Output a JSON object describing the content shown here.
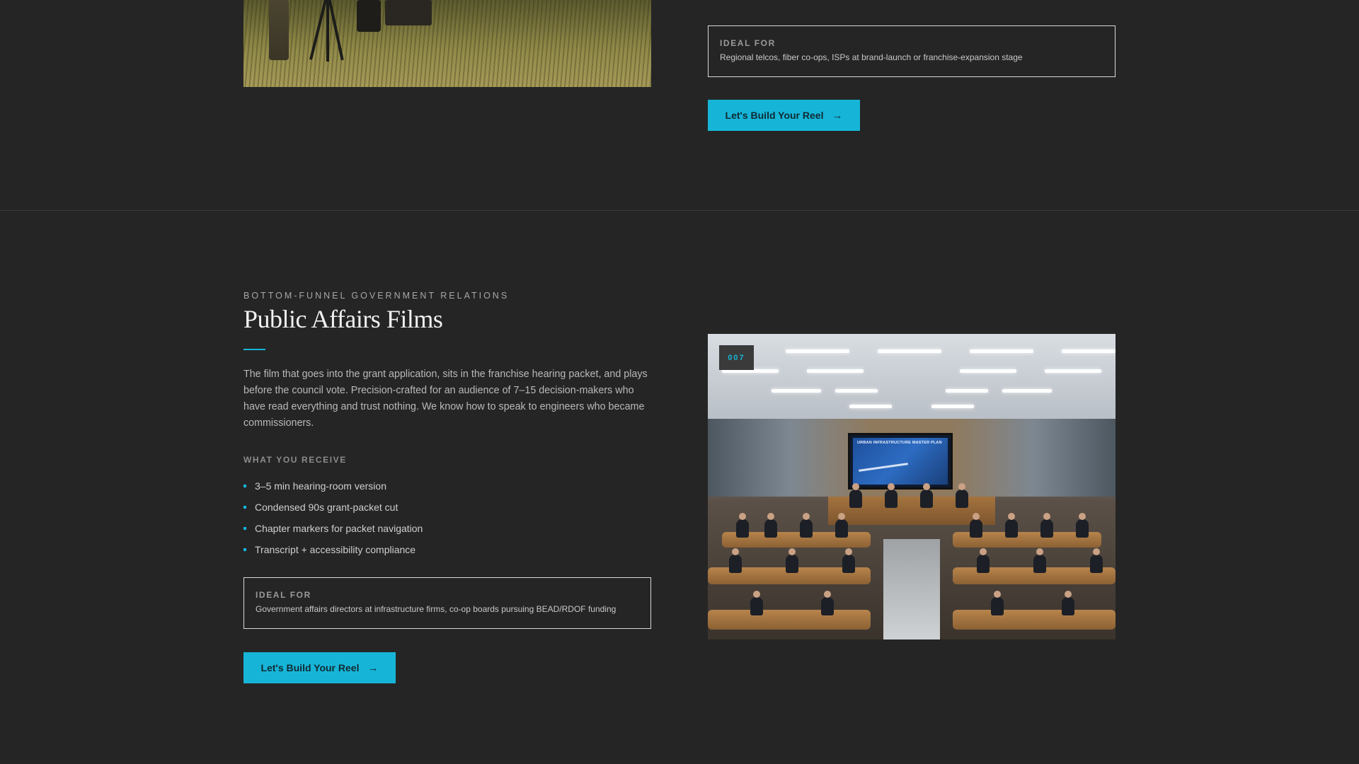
{
  "section_top": {
    "ideal": {
      "label": "IDEAL FOR",
      "text": "Regional telcos, fiber co-ops, ISPs at brand-launch or franchise-expansion stage"
    },
    "cta_label": "Let's Build Your Reel",
    "cta_icon": "arrow-right-icon"
  },
  "section_public_affairs": {
    "eyebrow": "BOTTOM-FUNNEL GOVERNMENT RELATIONS",
    "title": "Public Affairs Films",
    "description": "The film that goes into the grant application, sits in the franchise hearing packet, and plays before the council vote. Precision-crafted for an audience of 7–15 decision-makers who have read everything and trust nothing. We know how to speak to engineers who became commissioners.",
    "receive_label": "WHAT YOU RECEIVE",
    "receive_items": [
      "3–5 min hearing-room version",
      "Condensed 90s grant-packet cut",
      "Chapter markers for packet navigation",
      "Transcript + accessibility compliance"
    ],
    "ideal": {
      "label": "IDEAL FOR",
      "text": "Government affairs directors at infrastructure firms, co-op boards pursuing BEAD/RDOF funding"
    },
    "cta_label": "Let's Build Your Reel",
    "cta_icon": "arrow-right-icon",
    "image_tag": "007",
    "screen_caption": "URBAN INFRASTRUCTURE MASTER PLAN"
  },
  "colors": {
    "background": "#252525",
    "accent": "#16b5d8",
    "divider": "#3a3a3a"
  }
}
